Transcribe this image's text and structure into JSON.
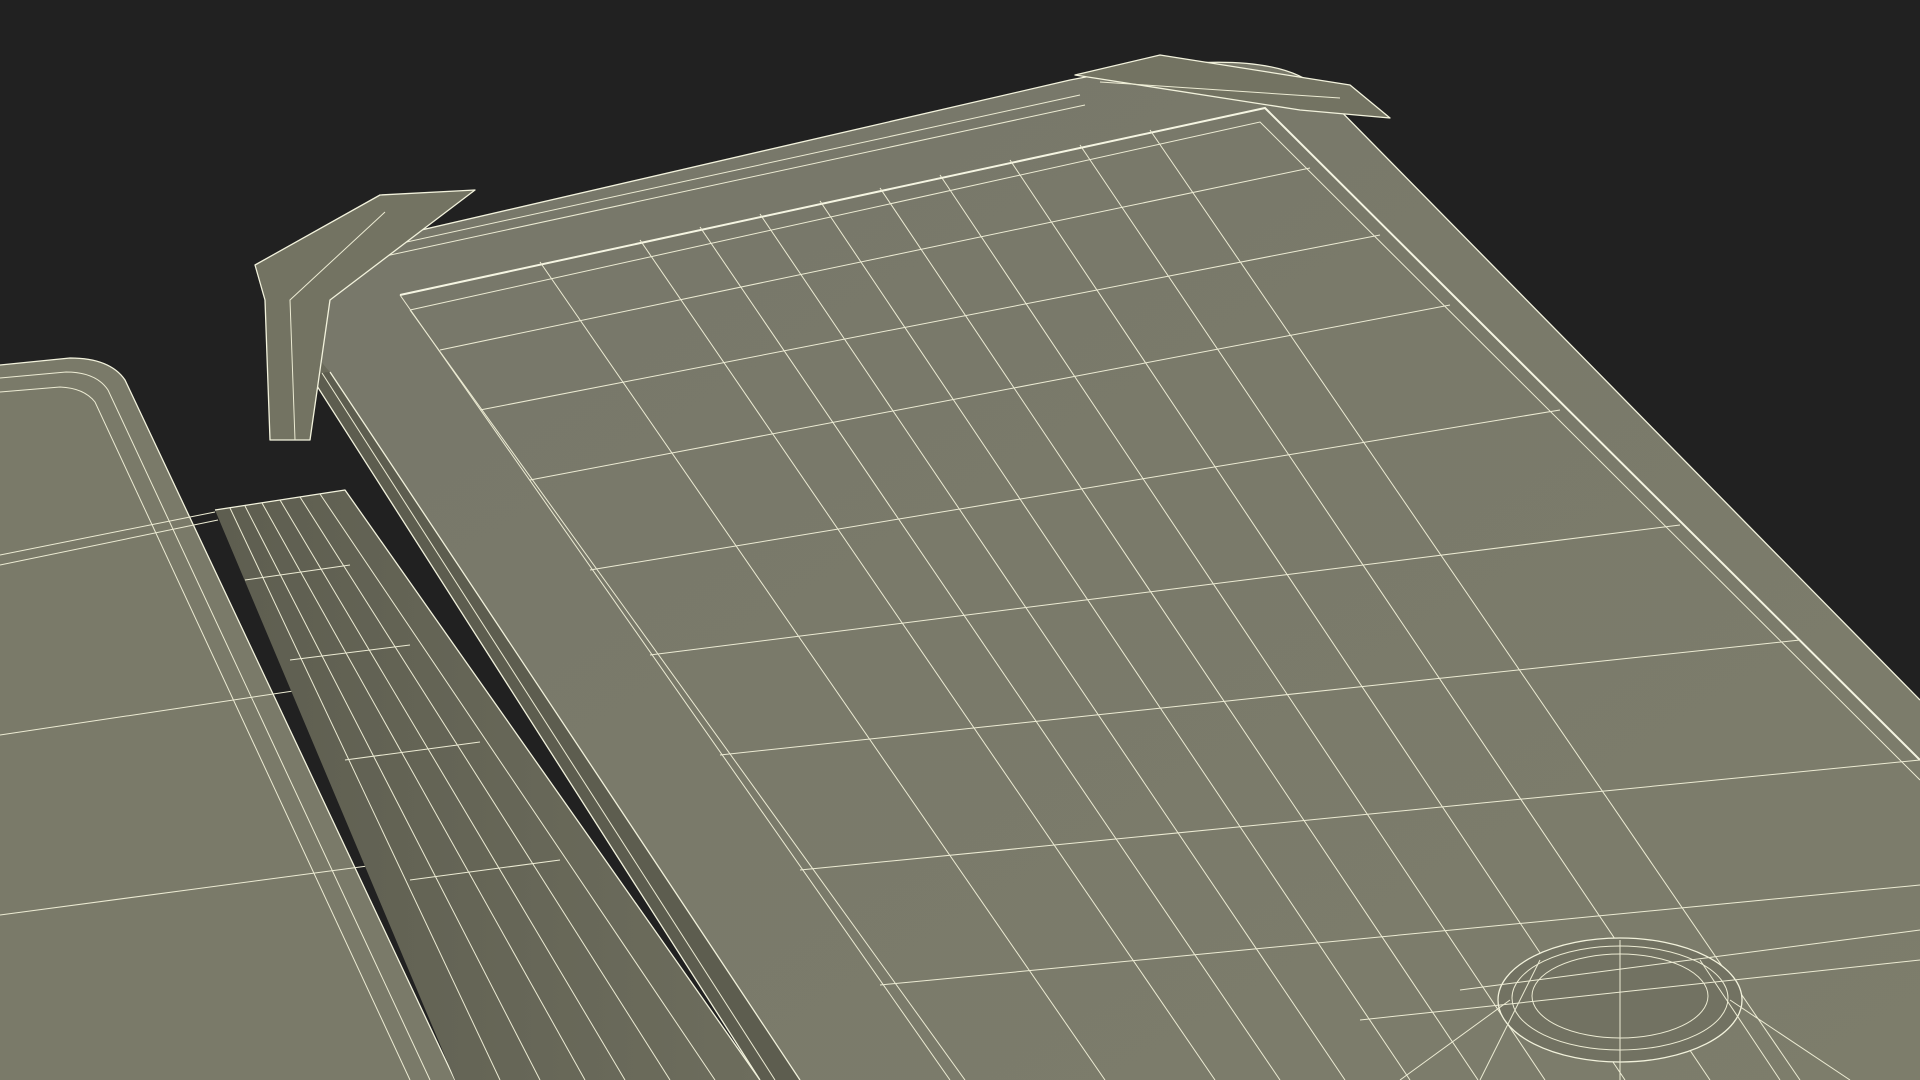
{
  "scene": {
    "subject": "wireframe-3d-render",
    "colors": {
      "background": "#212121",
      "surface": "#7a7a69",
      "surface_dark": "#6a6a5a",
      "surface_shadow": "#5d5d4f",
      "wire": "#f2f2dc"
    }
  }
}
